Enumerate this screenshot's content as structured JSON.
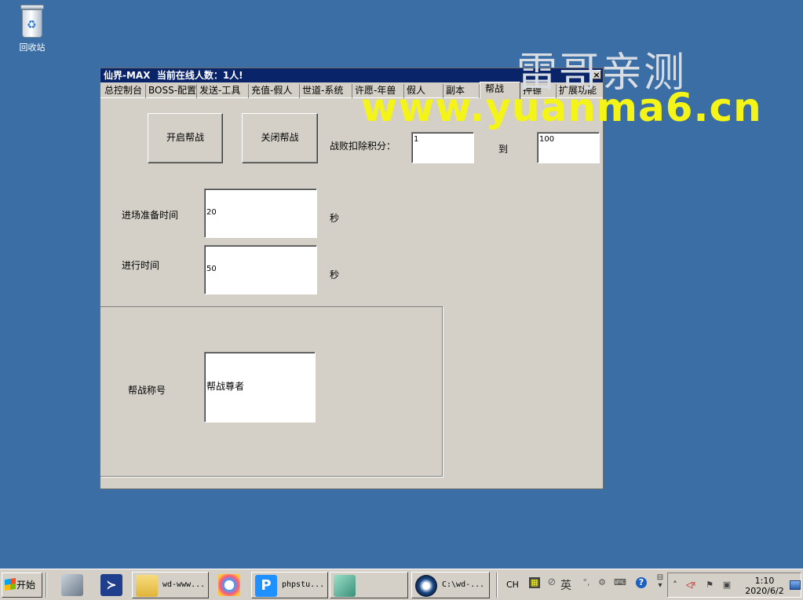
{
  "desktop": {
    "recycle_bin_label": "回收站"
  },
  "watermark": {
    "chinese": "雷哥亲测",
    "url": "www.yuanma6.cn"
  },
  "window": {
    "title": "仙界-MAX  当前在线人数：1人!",
    "close_glyph": "×",
    "tabs": [
      "总控制台",
      "BOSS-配置",
      "发送-工具",
      "充值-假人",
      "世道-系统",
      "许愿-年兽",
      "假人",
      "副本",
      "帮战",
      "押镖",
      "扩展功能"
    ],
    "active_tab": "帮战"
  },
  "guild_war": {
    "open_button": "开启帮战",
    "close_button": "关闭帮战",
    "deduct_label": "战败扣除积分：",
    "deduct_min": "1",
    "to_label": "到",
    "deduct_max": "100",
    "prep_time_label": "进场准备时间",
    "prep_time_value": "20",
    "prep_time_unit": "秒",
    "run_time_label": "进行时间",
    "run_time_value": "50",
    "run_time_unit": "秒",
    "title_label": "帮战称号",
    "title_value": "帮战尊者"
  },
  "taskbar": {
    "start_label": "开始",
    "tasks": [
      {
        "label": "wd-www...",
        "icon": "folder-icon"
      },
      {
        "label": "phpstu...",
        "icon": "phpstudy-icon"
      },
      {
        "label": "",
        "icon": "app-icon"
      },
      {
        "label": "C:\\wd-...",
        "icon": "console-app-icon"
      }
    ],
    "lang_label": "CH",
    "ime_label": "英",
    "clock_time": "1:10",
    "clock_date": "2020/6/2"
  }
}
